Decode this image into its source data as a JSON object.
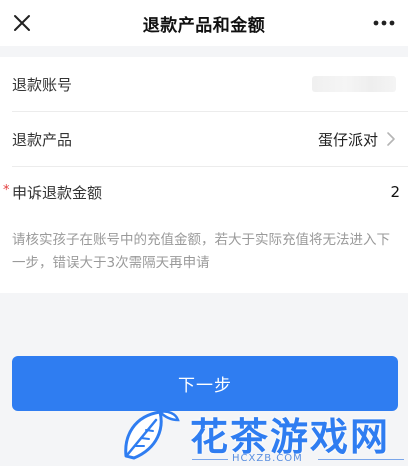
{
  "header": {
    "title": "退款产品和金额",
    "close_icon": "close-icon",
    "more_icon": "more-icon"
  },
  "form": {
    "account_label": "退款账号",
    "product_label": "退款产品",
    "product_value": "蛋仔派对",
    "amount_required_mark": "*",
    "amount_label": "申诉退款金额",
    "amount_value": "2",
    "hint": "请核实孩子在账号中的充值金额，若大于实际充值将无法进入下一步，错误大于3次需隔天再申请"
  },
  "footer": {
    "next_label": "下一步"
  },
  "watermark": {
    "text": "花茶游戏网",
    "url": "HCXZB.COM"
  },
  "colors": {
    "accent": "#2f7df1",
    "required": "#e23b3b",
    "hint": "#9a9a9a",
    "background": "#f4f5f7"
  }
}
